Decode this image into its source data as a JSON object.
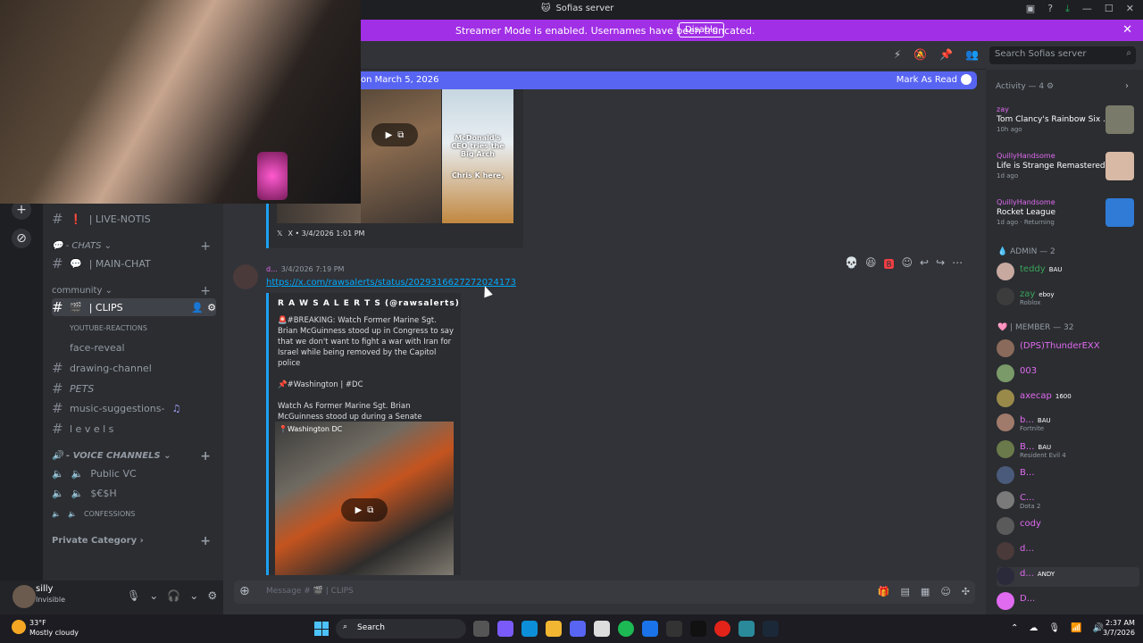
{
  "window": {
    "title": "Sofias server"
  },
  "banner": {
    "text": "Streamer Mode is enabled. Usernames have been truncated.",
    "disable_label": "Disable"
  },
  "new_messages": {
    "since": "on March 5, 2026",
    "mark_read": "Mark As Read"
  },
  "channels": {
    "live_notis": "| LIVE-NOTIS",
    "chats_category": "- CHATS",
    "main_chat": "| MAIN-CHAT",
    "community_category": "community",
    "clips": "| CLIPS",
    "youtube_reactions": "YOUTUBE-REACTIONS",
    "face_reveal": "face-reveal",
    "drawing_channel": "drawing-channel",
    "pets": "PETS",
    "music_suggestions": "music-suggestions-",
    "levels": "l e v e l s",
    "voice_category": "- VOICE CHANNELS",
    "public_vc": "Public VC",
    "sesh": "$€$H",
    "confessions": "CONFESSIONS",
    "private_category": "Private Category"
  },
  "user": {
    "name": "silly",
    "status": "Invisible"
  },
  "embed_top": {
    "caption1": "McDonald's CEO tries the Big Arch",
    "caption2": "Chris K here,",
    "footer": "X • 3/4/2026 1:01 PM"
  },
  "message": {
    "author": "d...",
    "timestamp": "3/4/2026 7:19 PM",
    "link": "https://x.com/rawsalerts/status/2029316627272024173",
    "embed_author": "R A W S A L E R T S (@rawsalerts)",
    "embed_body": "🚨#BREAKING: Watch Former Marine Sgt. Brian McGuinness stood up in Congress to say that we don't want to fight a war with Iran for Israel while being removed by the Capitol police\n\n📌#Washington | #DC\n\nWatch As Former Marine Sgt. Brian McGuinness stood up during a Senate",
    "video_location": "Washington DC"
  },
  "composer": {
    "placeholder": "Message # 🎬 | CLIPS"
  },
  "search": {
    "placeholder": "Search Sofias server"
  },
  "activity": {
    "header": "Activity — 4",
    "items": [
      {
        "who": "zay",
        "game": "Tom Clancy's Rainbow Six ...",
        "time": "10h ago"
      },
      {
        "who": "QuillyHandsome",
        "game": "Life is Strange Remastered",
        "time": "1d ago"
      },
      {
        "who": "QuillyHandsome",
        "game": "Rocket League",
        "time": "1d ago · Returning"
      }
    ]
  },
  "members": {
    "admin_header": "ADMIN — 2",
    "admins": [
      {
        "name": "teddy",
        "badge": "BAU",
        "sub": ""
      },
      {
        "name": "zay",
        "badge": "eboy",
        "sub": "Roblox"
      }
    ],
    "member_header": "| MEMBER — 32",
    "list": [
      {
        "name": "(DPS)ThunderEXX",
        "badge": "",
        "sub": ""
      },
      {
        "name": "003",
        "badge": "",
        "sub": ""
      },
      {
        "name": "axecap",
        "badge": "1600",
        "sub": ""
      },
      {
        "name": "b...",
        "badge": "BAU",
        "sub": "Fortnite"
      },
      {
        "name": "B...",
        "badge": "BAU",
        "sub": "Resident Evil 4"
      },
      {
        "name": "B...",
        "badge": "",
        "sub": ""
      },
      {
        "name": "C...",
        "badge": "",
        "sub": "Dota 2"
      },
      {
        "name": "cody",
        "badge": "",
        "sub": ""
      },
      {
        "name": "d...",
        "badge": "",
        "sub": ""
      },
      {
        "name": "d...",
        "badge": "ANDY",
        "sub": ""
      },
      {
        "name": "D...",
        "badge": "",
        "sub": ""
      }
    ]
  },
  "taskbar": {
    "temp": "33°F",
    "weather": "Mostly cloudy",
    "search": "Search",
    "time": "2:37 AM",
    "date": "3/7/2026"
  },
  "colors": {
    "accent": "#5865f2",
    "banner": "#a12fe6",
    "name_pink": "#e06af0",
    "link": "#00a8fc"
  }
}
